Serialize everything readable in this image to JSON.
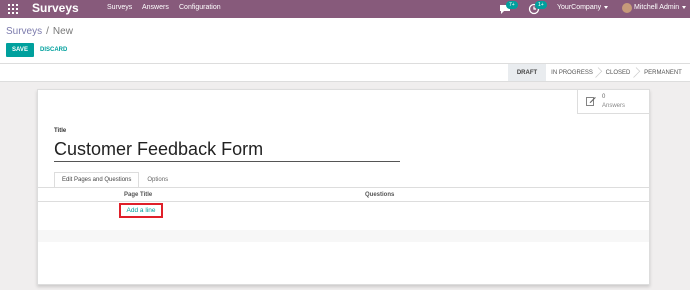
{
  "navbar": {
    "brand": "Surveys",
    "menu": [
      "Surveys",
      "Answers",
      "Configuration"
    ],
    "messages_badge": "7+",
    "activities_badge": "1+",
    "company": "YourCompany",
    "user": "Mitchell Admin",
    "icons": [
      "apps-grid-icon",
      "chat-icon",
      "clock-icon",
      "caret-down-icon",
      "avatar"
    ],
    "color": "#875a7b"
  },
  "control_panel": {
    "breadcrumb": {
      "parent": "Surveys",
      "separator": "/",
      "current": "New"
    },
    "save_label": "SAVE",
    "discard_label": "DISCARD",
    "accent": "#00a09d"
  },
  "statusbar": {
    "stages": [
      "DRAFT",
      "IN PROGRESS",
      "CLOSED",
      "PERMANENT"
    ],
    "active_stage": "DRAFT"
  },
  "form": {
    "answers_count": "0",
    "answers_label": "Answers",
    "title_label": "Title",
    "title_value": "Customer Feedback Form",
    "tabs": [
      "Edit Pages and Questions",
      "Options"
    ],
    "active_tab": "Edit Pages and Questions",
    "columns": [
      "Page Title",
      "Questions"
    ],
    "add_line": "Add a line",
    "highlight_color": "#e0202a"
  }
}
